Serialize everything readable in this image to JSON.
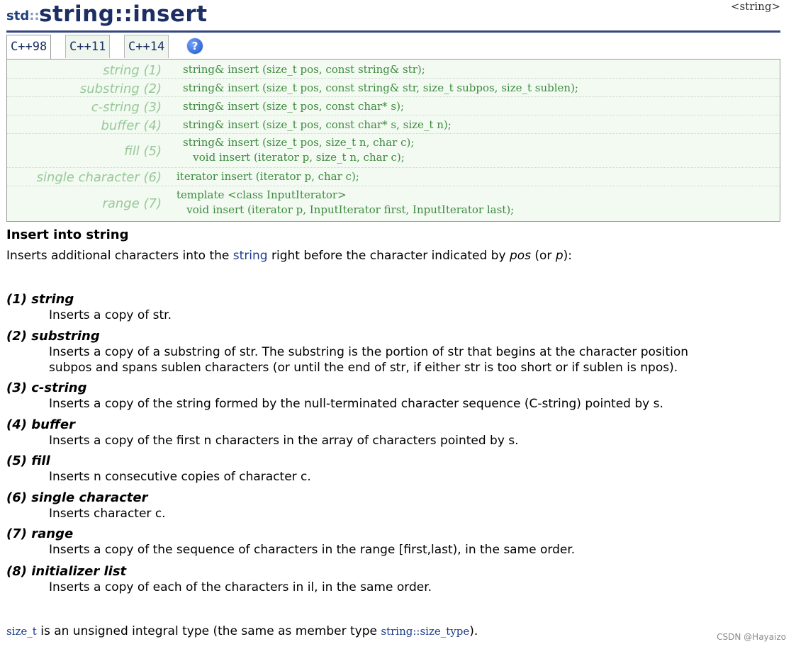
{
  "header": {
    "namespace": "std",
    "ns_sep": "::",
    "function": "string",
    "func_sep": "::",
    "member": "insert",
    "file": "<string>"
  },
  "tabs": [
    {
      "label": "C++98",
      "active": true
    },
    {
      "label": "C++11",
      "active": false
    },
    {
      "label": "C++14",
      "active": false
    }
  ],
  "help_icon": {
    "glyph": "?",
    "icon": "help-icon"
  },
  "prototypes": [
    {
      "label": "string (1)",
      "code": "string& insert (size_t pos, const string& str);"
    },
    {
      "label": "substring (2)",
      "code": "string& insert (size_t pos, const string& str, size_t subpos, size_t sublen);"
    },
    {
      "label": "c-string (3)",
      "code": "string& insert (size_t pos, const char* s);"
    },
    {
      "label": "buffer (4)",
      "code": "string& insert (size_t pos, const char* s, size_t n);"
    },
    {
      "label": "fill (5)",
      "code": "string& insert (size_t pos, size_t n, char c);\n   void insert (iterator p, size_t n, char c);"
    },
    {
      "label": "single character (6)",
      "code": "iterator insert (iterator p, char c);"
    },
    {
      "label": "range (7)",
      "code": "template <class InputIterator>\n   void insert (iterator p, InputIterator first, InputIterator last);"
    }
  ],
  "description": {
    "heading": "Insert into string",
    "intro_before": "Inserts additional characters into the ",
    "intro_link": "string",
    "intro_mid": " right before the character indicated by ",
    "intro_pos": "pos",
    "intro_or": " (or ",
    "intro_p": "p",
    "intro_end": "):"
  },
  "items": [
    {
      "title": "(1) string",
      "lines": [
        "Inserts a copy of str."
      ]
    },
    {
      "title": "(2) substring",
      "lines": [
        "Inserts a copy of a substring of str. The substring is the portion of str that begins at the character position",
        "subpos and spans sublen characters (or until the end of str, if either str is too short or if sublen is npos)."
      ]
    },
    {
      "title": "(3) c-string",
      "lines": [
        "Inserts a copy of the string formed by the null-terminated character sequence (C-string) pointed by s."
      ]
    },
    {
      "title": "(4) buffer",
      "lines": [
        "Inserts a copy of the first n characters in the array of characters pointed by s."
      ]
    },
    {
      "title": "(5) fill",
      "lines": [
        "Inserts n consecutive copies of character c."
      ]
    },
    {
      "title": "(6) single character",
      "lines": [
        "Inserts character c."
      ]
    },
    {
      "title": "(7) range",
      "lines": [
        "Inserts a copy of the sequence of characters in the range [first,last), in the same order."
      ]
    },
    {
      "title": "(8) initializer list",
      "lines": [
        "Inserts a copy of each of the characters in il, in the same order."
      ]
    }
  ],
  "footer": {
    "type_link": "size_t",
    "text_mid": " is an unsigned integral type (the same as member type ",
    "member_link": "string::size_type",
    "text_end": ")."
  },
  "watermark": "CSDN @Hayaizo"
}
